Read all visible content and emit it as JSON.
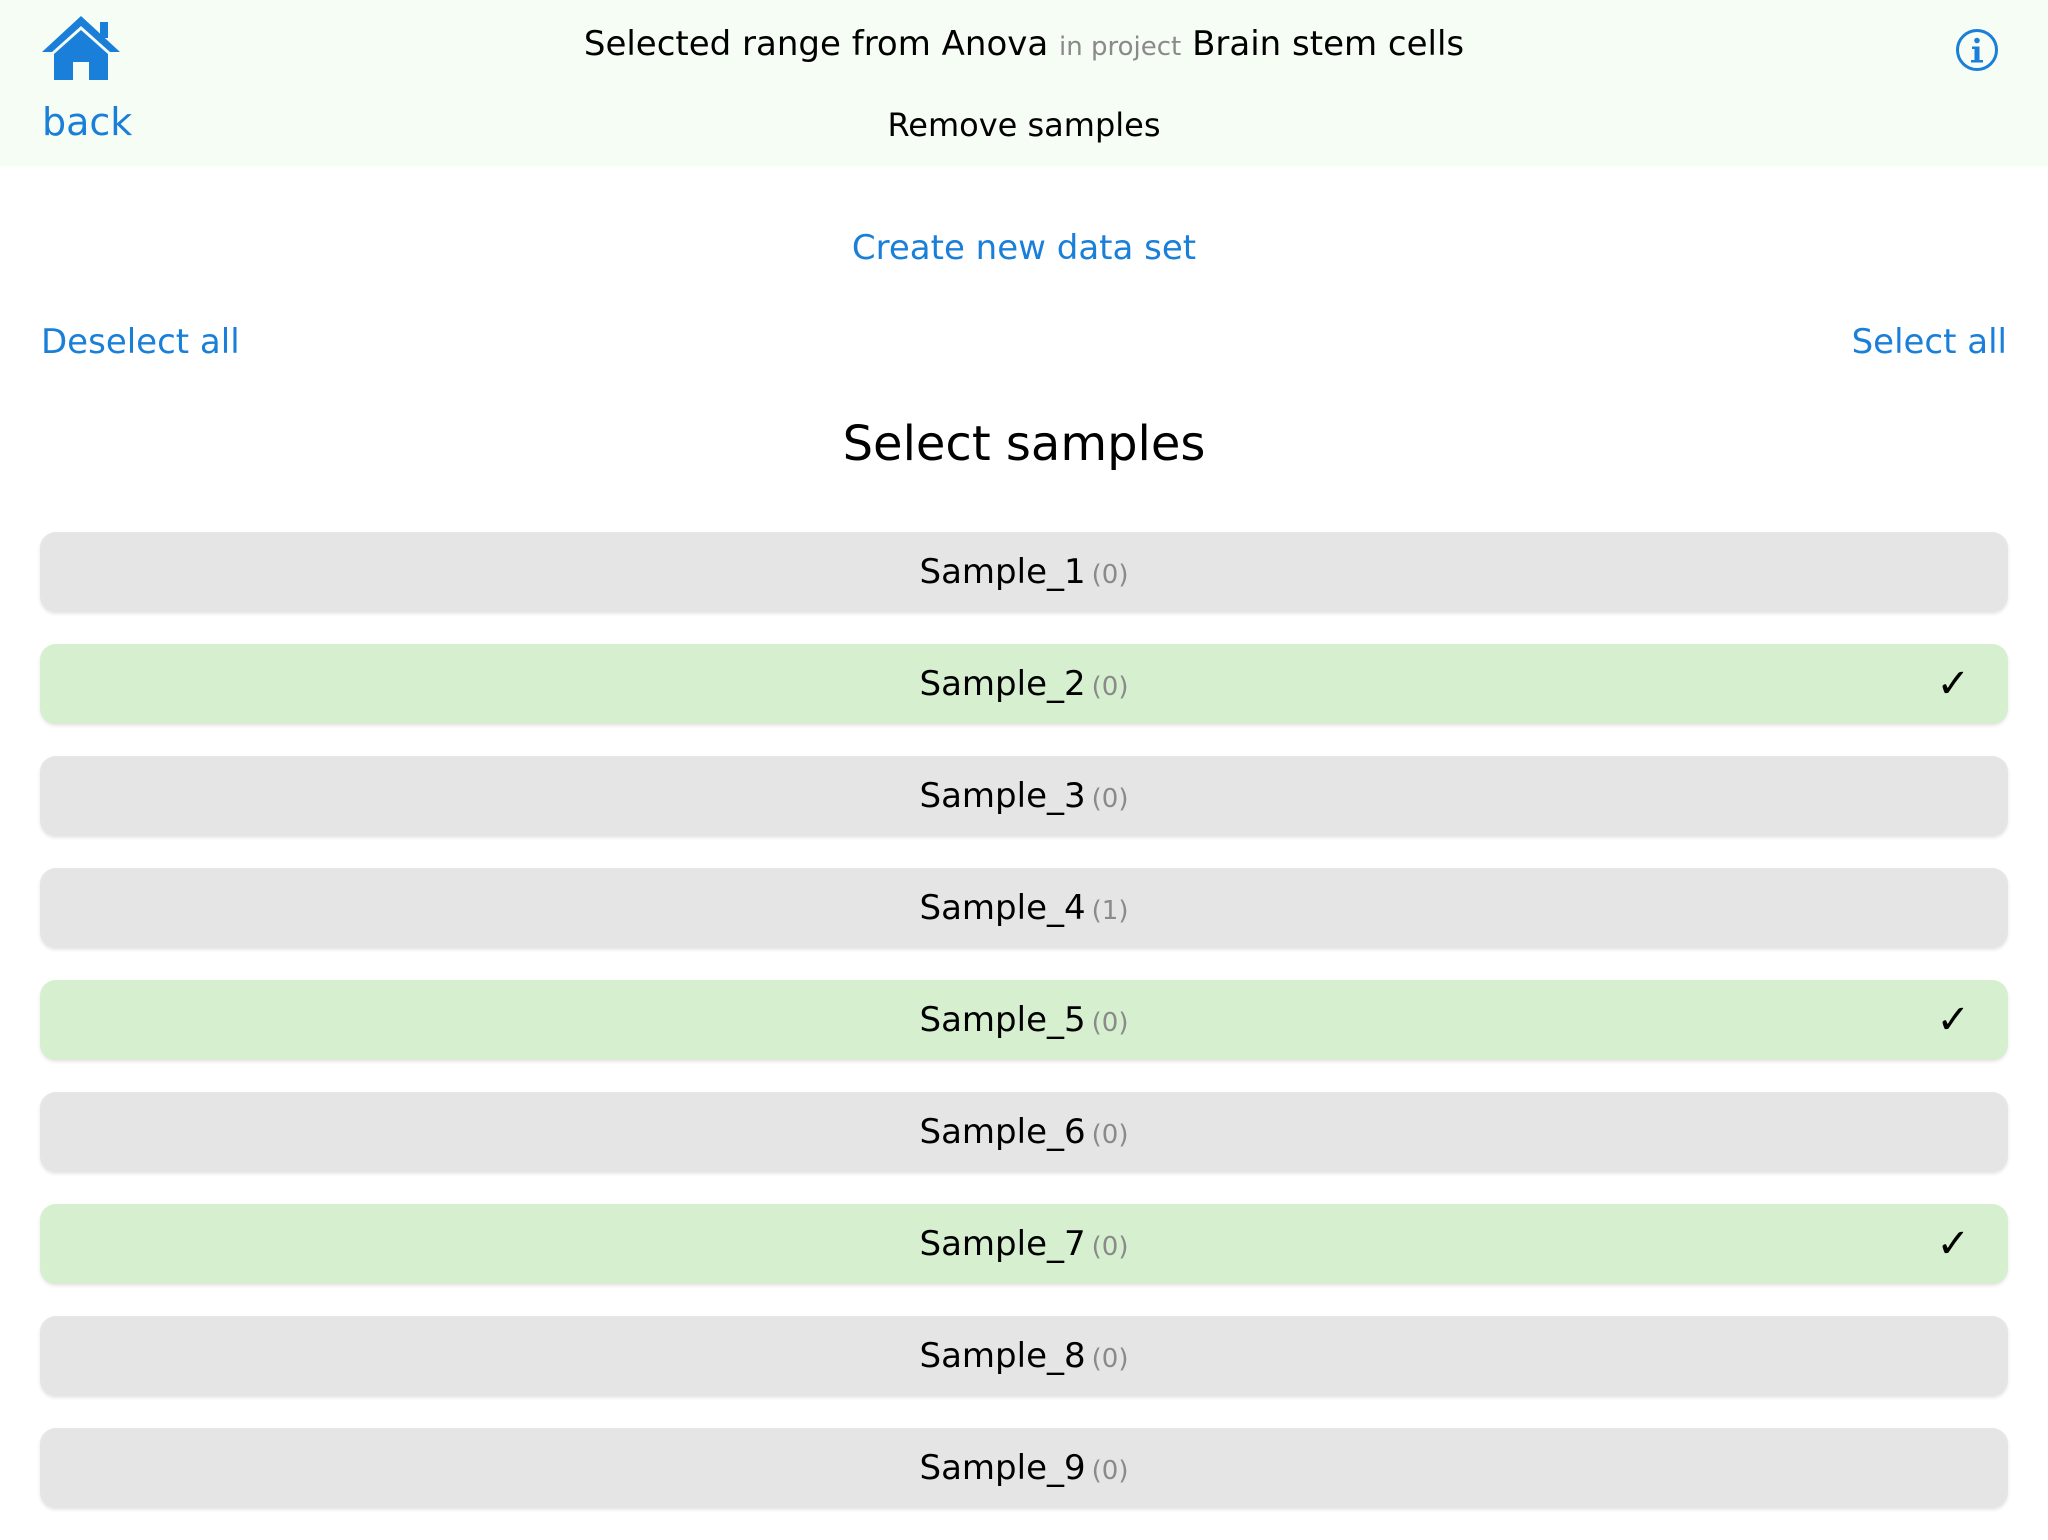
{
  "header": {
    "back_label": "back",
    "title_prefix": "Selected range from Anova",
    "title_connector": "in project",
    "project_name": "Brain stem cells",
    "subtitle": "Remove samples"
  },
  "actions": {
    "create_label": "Create new data set",
    "deselect_label": "Deselect all",
    "select_label": "Select all"
  },
  "section_title": "Select samples",
  "samples": [
    {
      "name": "Sample_1",
      "count": "(0)",
      "selected": false
    },
    {
      "name": "Sample_2",
      "count": "(0)",
      "selected": true
    },
    {
      "name": "Sample_3",
      "count": "(0)",
      "selected": false
    },
    {
      "name": "Sample_4",
      "count": "(1)",
      "selected": false
    },
    {
      "name": "Sample_5",
      "count": "(0)",
      "selected": true
    },
    {
      "name": "Sample_6",
      "count": "(0)",
      "selected": false
    },
    {
      "name": "Sample_7",
      "count": "(0)",
      "selected": true
    },
    {
      "name": "Sample_8",
      "count": "(0)",
      "selected": false
    },
    {
      "name": "Sample_9",
      "count": "(0)",
      "selected": false
    }
  ],
  "check_glyph": "✓",
  "icons": {
    "home": "home-icon",
    "info": "info-icon"
  },
  "colors": {
    "accent": "#1a7fd8",
    "header_bg": "#f6fdf4",
    "row_bg": "#e5e5e5",
    "row_selected_bg": "#d5efcf"
  }
}
